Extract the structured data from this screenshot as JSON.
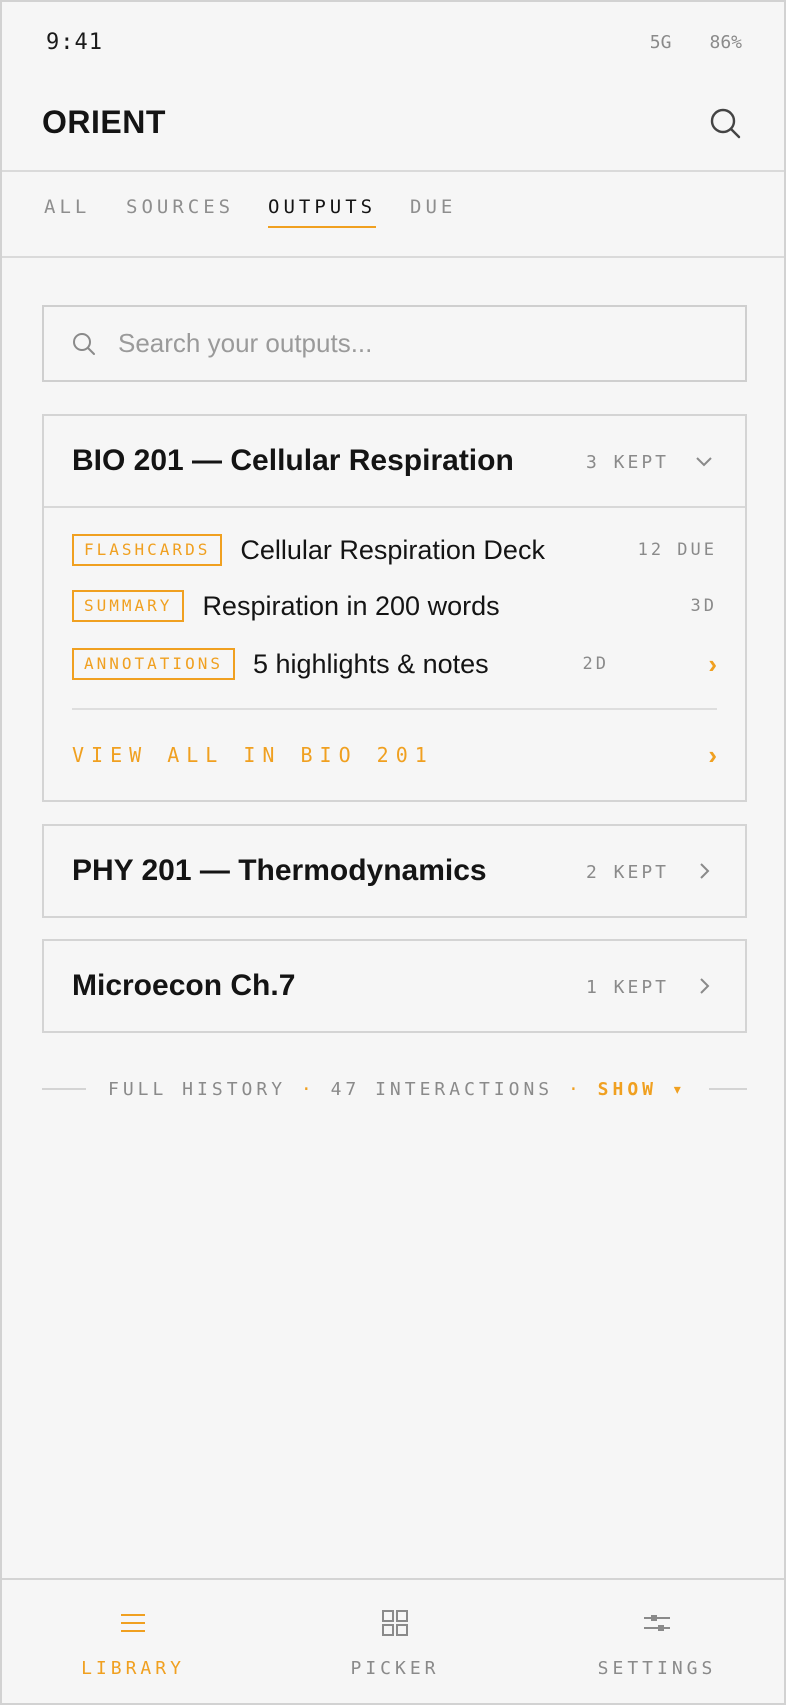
{
  "status": {
    "time": "9:41",
    "network": "5G",
    "battery": "86%"
  },
  "app": {
    "title": "ORIENT"
  },
  "tabs": [
    {
      "label": "ALL"
    },
    {
      "label": "SOURCES"
    },
    {
      "label": "OUTPUTS"
    },
    {
      "label": "DUE"
    }
  ],
  "active_tab": "OUTPUTS",
  "search": {
    "placeholder": "Search your outputs...",
    "value": ""
  },
  "groups": [
    {
      "title": "BIO 201 — Cellular Respiration",
      "kept": "3 KEPT",
      "expanded": true,
      "items": [
        {
          "tag": "FLASHCARDS",
          "text": "Cellular Respiration Deck",
          "meta": "12 DUE"
        },
        {
          "tag": "SUMMARY",
          "text": "Respiration in 200 words",
          "meta": "3D"
        },
        {
          "tag": "ANNOTATIONS",
          "text": "5 highlights & notes",
          "meta": "2D",
          "arrow": "›"
        }
      ],
      "view_all": "VIEW ALL IN BIO 201",
      "view_all_arrow": "›"
    },
    {
      "title": "PHY 201 — Thermodynamics",
      "kept": "2 KEPT",
      "expanded": false
    },
    {
      "title": "Microecon Ch.7",
      "kept": "1 KEPT",
      "expanded": false
    }
  ],
  "history": {
    "label": "FULL HISTORY",
    "sep": "·",
    "count": "47 INTERACTIONS",
    "action": "SHOW ▾"
  },
  "nav": [
    {
      "label": "LIBRARY",
      "icon": "menu-icon",
      "active": true
    },
    {
      "label": "PICKER",
      "icon": "grid-icon",
      "active": false
    },
    {
      "label": "SETTINGS",
      "icon": "sliders-icon",
      "active": false
    }
  ],
  "colors": {
    "accent": "#f0a020",
    "text": "#141414",
    "muted": "#8a8a8a",
    "border": "#d4d4d4",
    "background": "#f6f6f6"
  }
}
